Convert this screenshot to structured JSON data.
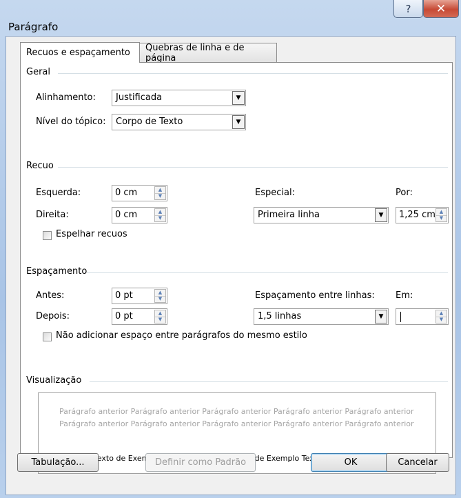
{
  "window": {
    "title": "Parágrafo",
    "help_glyph": "?",
    "close_glyph": "✕"
  },
  "tabs": [
    {
      "label": "Recuos e espaçamento",
      "active": true
    },
    {
      "label": "Quebras de linha e de página",
      "active": false
    }
  ],
  "geral": {
    "header": "Geral",
    "alinhamento_label": "Alinhamento:",
    "alinhamento_value": "Justificada",
    "nivel_label": "Nível do tópico:",
    "nivel_value": "Corpo de Texto"
  },
  "recuo": {
    "header": "Recuo",
    "esquerda_label": "Esquerda:",
    "esquerda_value": "0 cm",
    "direita_label": "Direita:",
    "direita_value": "0 cm",
    "especial_label": "Especial:",
    "especial_value": "Primeira linha",
    "por_label": "Por:",
    "por_value": "1,25 cm",
    "espelhar_label": "Espelhar recuos",
    "espelhar_checked": false
  },
  "espacamento": {
    "header": "Espaçamento",
    "antes_label": "Antes:",
    "antes_value": "0 pt",
    "depois_label": "Depois:",
    "depois_value": "0 pt",
    "entre_linhas_label": "Espaçamento entre linhas:",
    "entre_linhas_value": "1,5 linhas",
    "em_label": "Em:",
    "em_value": "",
    "nao_adicionar_label": "Não adicionar espaço entre parágrafos do mesmo estilo",
    "nao_adicionar_checked": false
  },
  "visualizacao": {
    "header": "Visualização",
    "previous_text": "Parágrafo anterior Parágrafo anterior Parágrafo anterior Parágrafo anterior Parágrafo anterior Parágrafo anterior Parágrafo anterior Parágrafo anterior Parágrafo anterior Parágrafo anterior",
    "sample_text": "Texto de Exemplo Texto de Exemplo Texto de Exemplo Texto de Exemplo Texto de"
  },
  "buttons": {
    "tabulacao": "Tabulação...",
    "definir_padrao": "Definir como Padrão",
    "ok": "OK",
    "cancelar": "Cancelar"
  },
  "icons": {
    "dropdown_arrow": "▼",
    "spin_up": "▲",
    "spin_down": "▼"
  }
}
